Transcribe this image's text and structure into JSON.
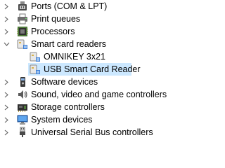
{
  "tree": {
    "items": [
      {
        "label": "Ports (COM & LPT)",
        "icon": "port-icon",
        "state": "collapsed"
      },
      {
        "label": "Print queues",
        "icon": "printer-icon",
        "state": "collapsed"
      },
      {
        "label": "Processors",
        "icon": "processor-icon",
        "state": "collapsed"
      },
      {
        "label": "Smart card readers",
        "icon": "smart-card-reader-icon",
        "state": "expanded",
        "children": [
          {
            "label": "OMNIKEY 3x21",
            "icon": "smart-card-reader-icon"
          },
          {
            "label": "USB Smart Card Reader",
            "icon": "smart-card-reader-icon",
            "selected": true
          }
        ]
      },
      {
        "label": "Software devices",
        "icon": "software-device-icon",
        "state": "collapsed"
      },
      {
        "label": "Sound, video and game controllers",
        "icon": "speaker-icon",
        "state": "collapsed"
      },
      {
        "label": "Storage controllers",
        "icon": "storage-controller-icon",
        "state": "collapsed"
      },
      {
        "label": "System devices",
        "icon": "system-device-icon",
        "state": "collapsed"
      },
      {
        "label": "Universal Serial Bus controllers",
        "icon": "usb-icon",
        "state": "collapsed"
      }
    ]
  },
  "colors": {
    "selection": "#cce8ff",
    "text": "#000000",
    "chevron": "#5f5f5f"
  }
}
